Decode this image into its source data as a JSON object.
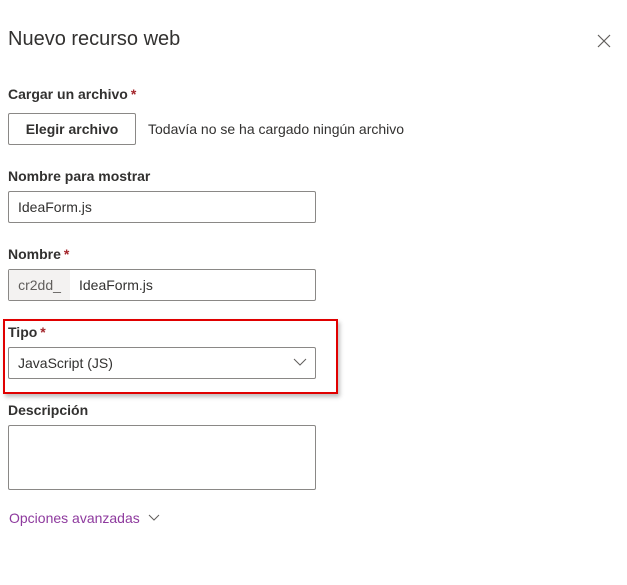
{
  "panel": {
    "title": "Nuevo recurso web",
    "close_icon": "close-icon"
  },
  "upload": {
    "label": "Cargar un archivo",
    "required": "*",
    "button": "Elegir archivo",
    "status": "Todavía no se ha cargado ningún archivo"
  },
  "display_name": {
    "label": "Nombre para mostrar",
    "value": "IdeaForm.js"
  },
  "name": {
    "label": "Nombre",
    "required": "*",
    "prefix": "cr2dd_",
    "value": "IdeaForm.js"
  },
  "type": {
    "label": "Tipo",
    "required": "*",
    "value": "JavaScript (JS)"
  },
  "description": {
    "label": "Descripción",
    "value": ""
  },
  "advanced": {
    "label": "Opciones avanzadas"
  },
  "colors": {
    "highlight": "#e00000",
    "link": "#8e3a9e",
    "required": "#a4262c"
  }
}
